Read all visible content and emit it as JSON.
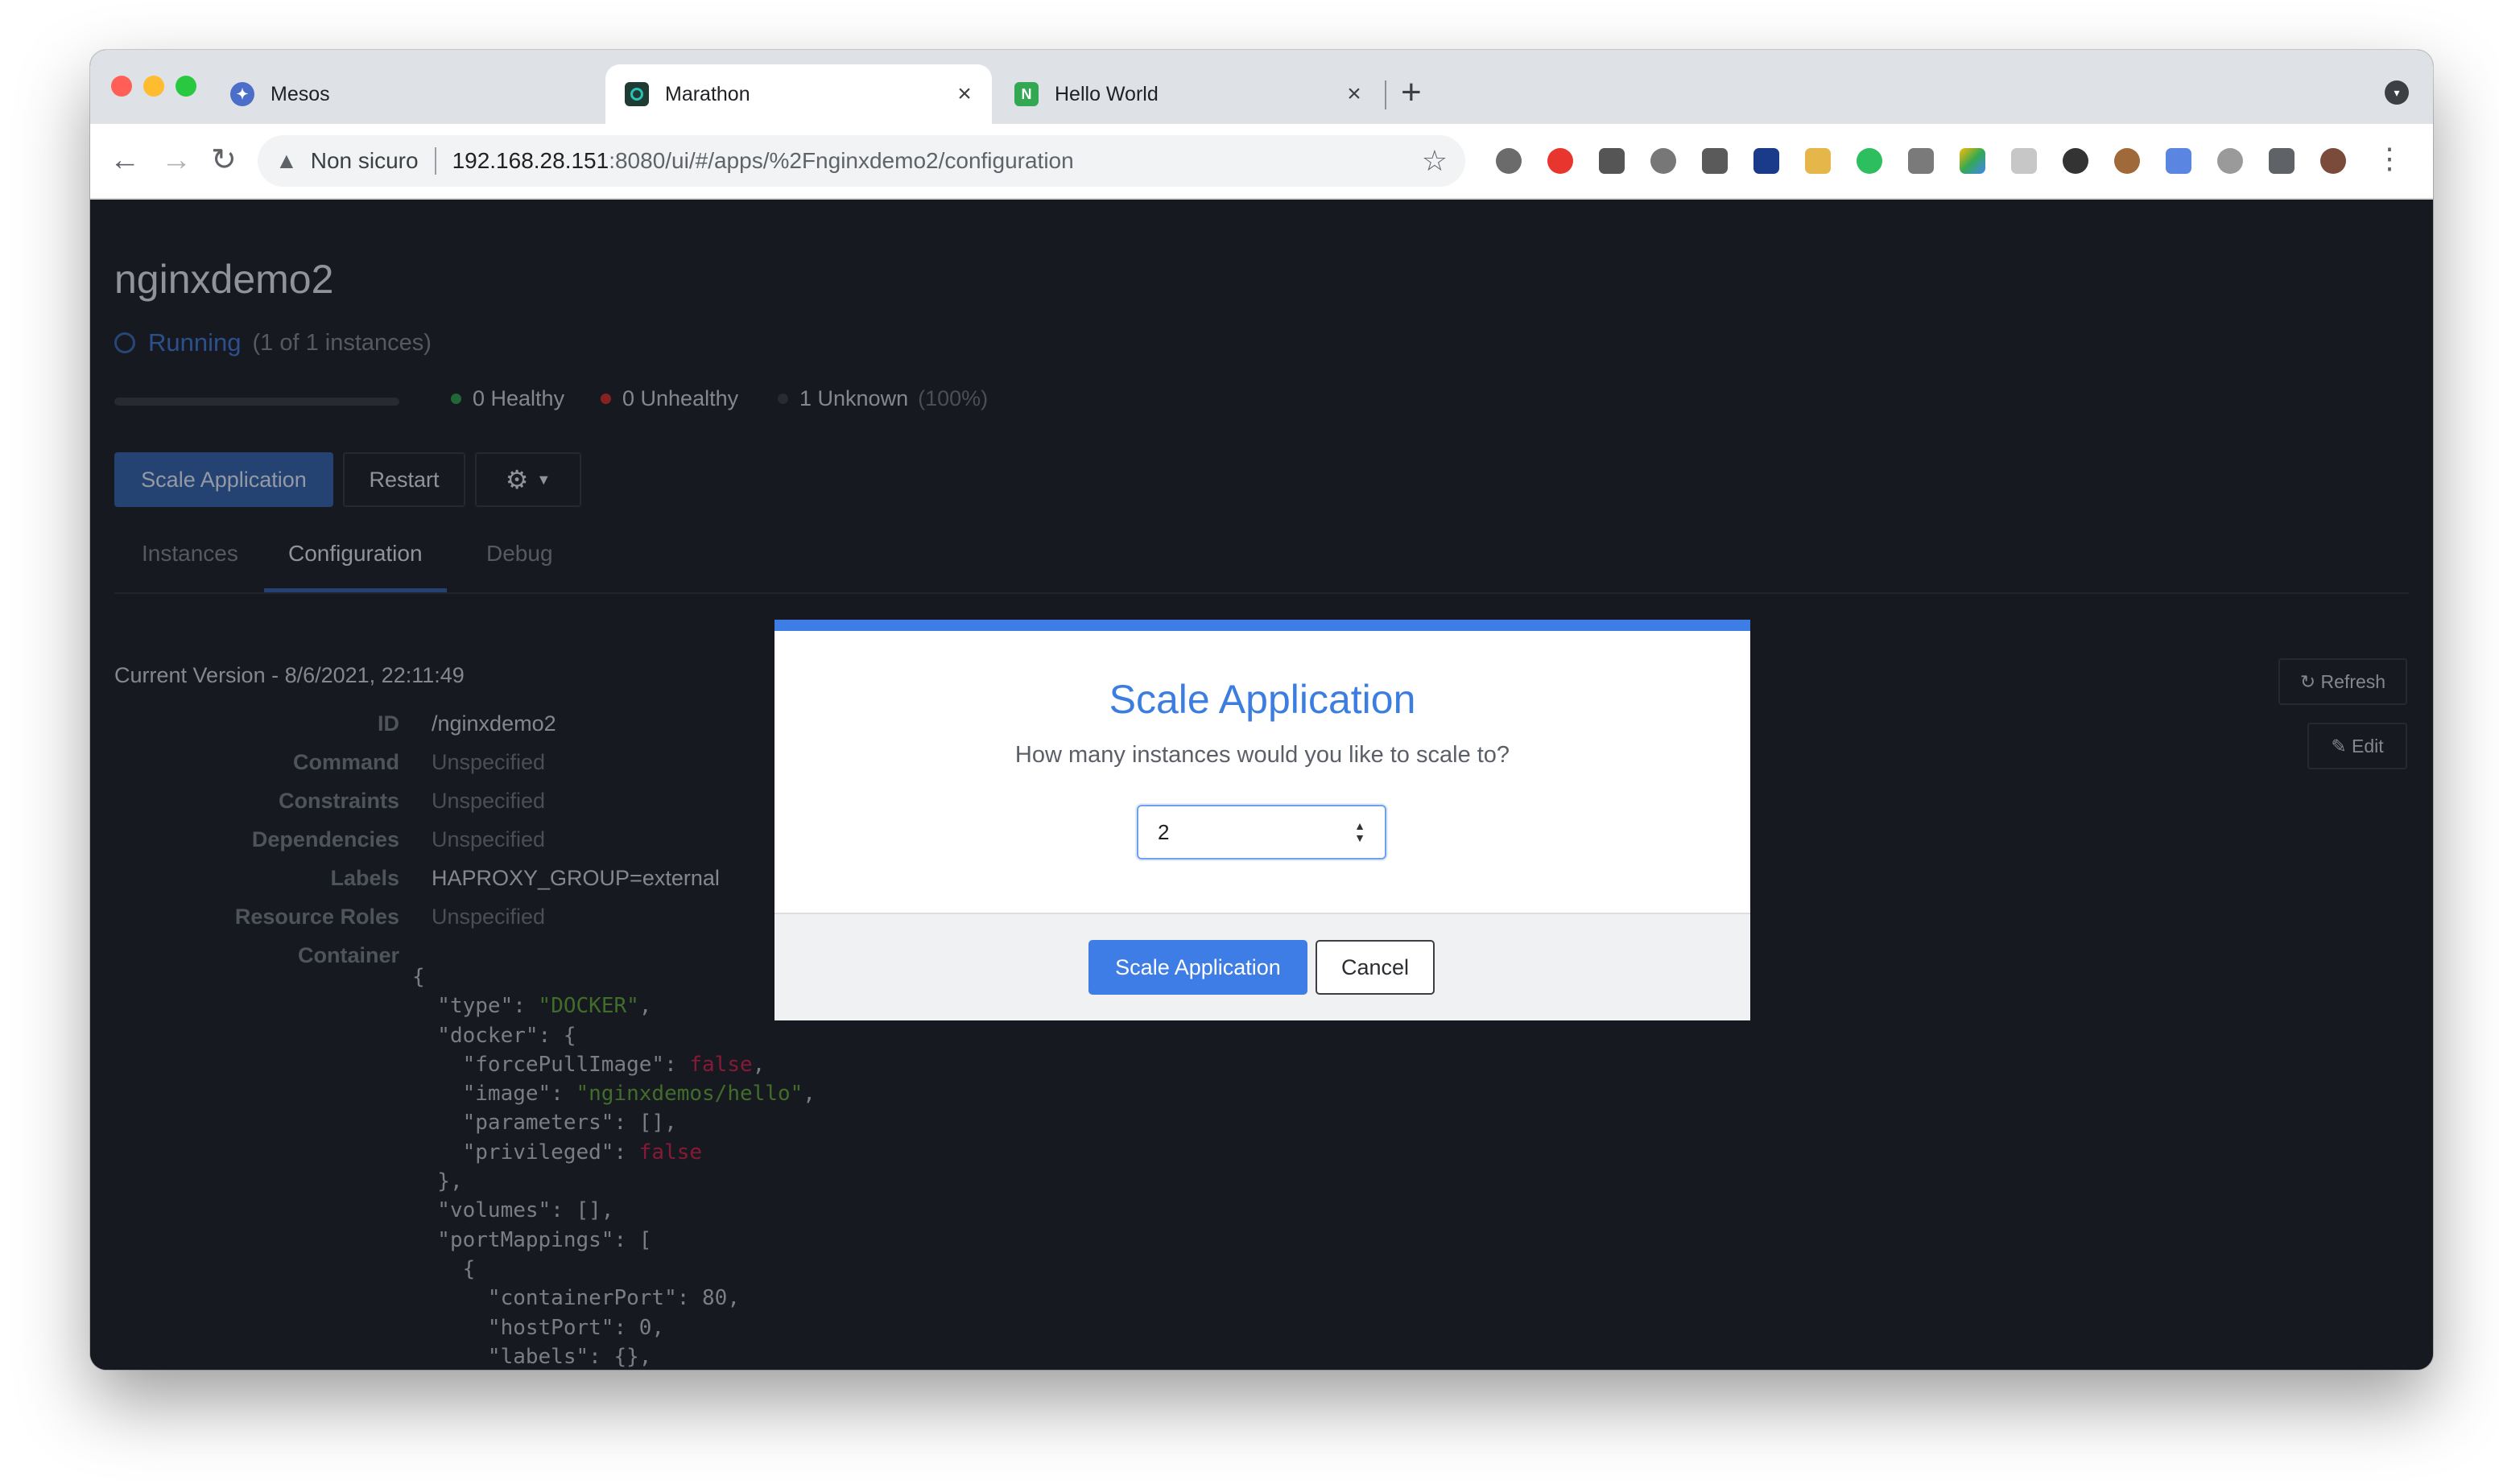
{
  "browser": {
    "tabs": [
      {
        "title": "Mesos",
        "close": "×",
        "favicon_color": "#4b6fc9",
        "active": false
      },
      {
        "title": "Marathon",
        "close": "×",
        "favicon_color": "#1f3b33",
        "active": true
      },
      {
        "title": "Hello World",
        "close": "×",
        "favicon_color": "#32a852",
        "active": false
      }
    ],
    "new_tab": "+",
    "address": {
      "security_label": "Non sicuro",
      "host": "192.168.28.151",
      "rest": ":8080/ui/#/apps/%2Fnginxdemo2/configuration"
    }
  },
  "app": {
    "name": "nginxdemo2",
    "status": "Running",
    "instances_text": "(1 of 1 instances)",
    "health": {
      "healthy": "0 Healthy",
      "unhealthy": "0 Unhealthy",
      "unknown": "1 Unknown",
      "unknown_pct": "(100%)"
    },
    "actions": {
      "scale": "Scale Application",
      "restart": "Restart"
    },
    "tabs": [
      "Instances",
      "Configuration",
      "Debug"
    ],
    "active_tab": "Configuration",
    "version": "Current Version - 8/6/2021, 22:11:49",
    "refresh_label": "↻ Refresh",
    "edit_label": "✎ Edit",
    "config": [
      {
        "key": "ID",
        "value": "/nginxdemo2"
      },
      {
        "key": "Command",
        "value": "Unspecified"
      },
      {
        "key": "Constraints",
        "value": "Unspecified"
      },
      {
        "key": "Dependencies",
        "value": "Unspecified"
      },
      {
        "key": "Labels",
        "value": "HAPROXY_GROUP=external"
      },
      {
        "key": "Resource Roles",
        "value": "Unspecified"
      },
      {
        "key": "Container",
        "value": ""
      }
    ]
  },
  "modal": {
    "title": "Scale Application",
    "subtitle": "How many instances would you like to scale to?",
    "instances_value": "2",
    "primary_label": "Scale Application",
    "cancel_label": "Cancel"
  },
  "colors": {
    "accent": "#3f7de6",
    "page_bg": "#20232a",
    "healthy": "#2e9c4e",
    "unhealthy": "#c9302c"
  }
}
